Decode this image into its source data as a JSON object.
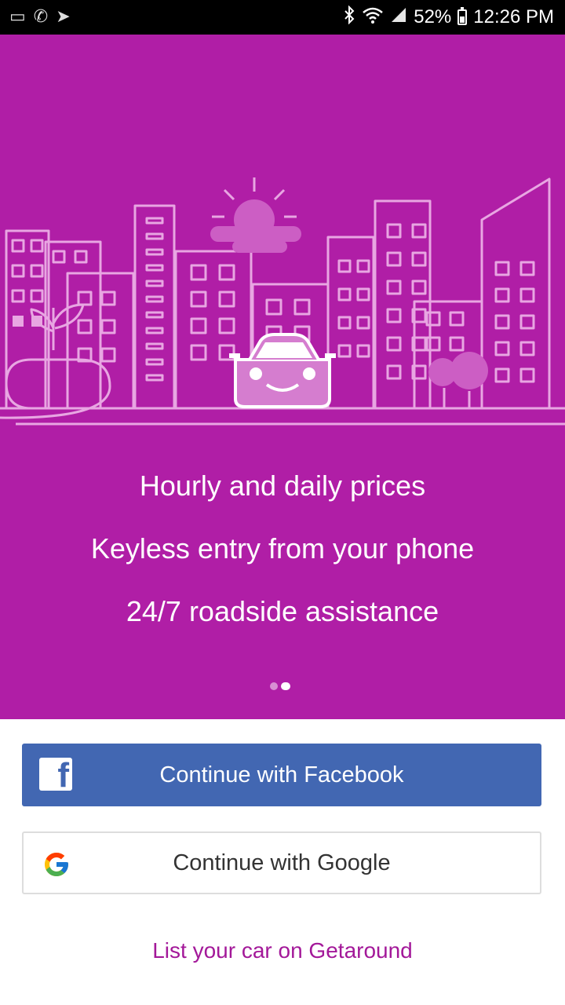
{
  "status_bar": {
    "battery": "52%",
    "time": "12:26 PM",
    "icons": [
      "bluetooth-icon",
      "wifi-icon",
      "signal-icon",
      "battery-icon"
    ]
  },
  "hero": {
    "background_color": "#b01ea6",
    "illustration": "city-with-car",
    "features": [
      "Hourly and daily prices",
      "Keyless entry from your phone",
      "24/7 roadside assistance"
    ],
    "page_indicator": {
      "count": 2,
      "active": 2
    }
  },
  "buttons": {
    "facebook": {
      "label": "Continue with Facebook",
      "icon": "facebook-icon",
      "color": "#4267b2"
    },
    "google": {
      "label": "Continue with Google",
      "icon": "google-icon"
    }
  },
  "list_car_link": "List your car on Getaround"
}
